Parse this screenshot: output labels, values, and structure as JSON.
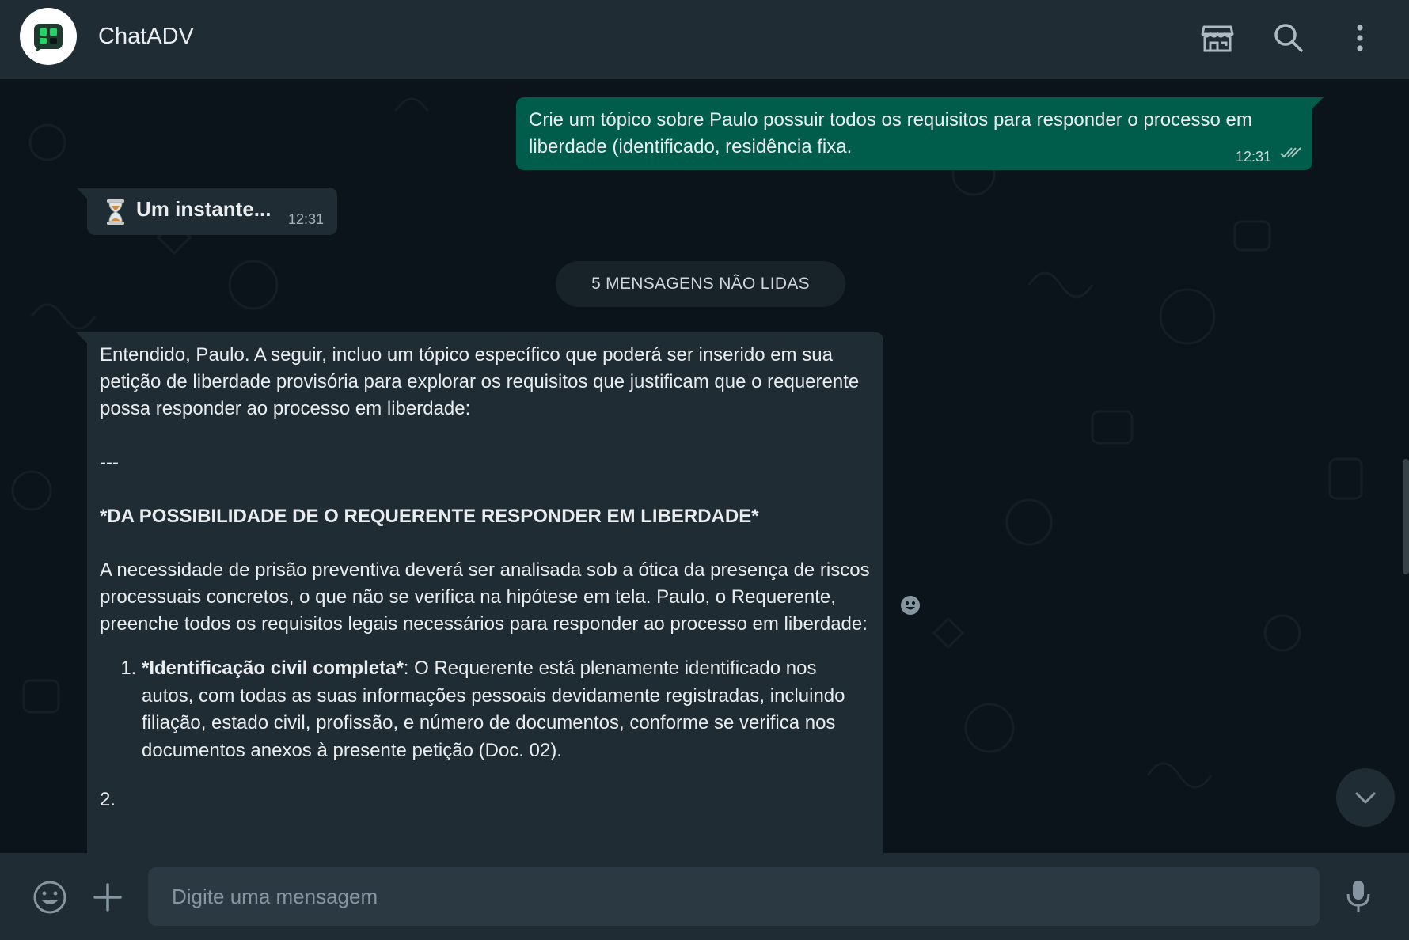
{
  "header": {
    "title": "ChatADV",
    "avatar_icon": "chatadv-logo-icon",
    "icons": [
      "store-icon",
      "search-icon",
      "menu-icon"
    ]
  },
  "messages": {
    "outgoing": {
      "text": "Crie um tópico sobre Paulo possuir todos os requisitos para responder o processo em liberdade (identificado, residência fixa.",
      "time": "12:31",
      "status_icon": "double-check-icon"
    },
    "waiting": {
      "icon": "hourglass-icon",
      "text": "Um instante...",
      "time": "12:31"
    },
    "unread_banner": "5 MENSAGENS NÃO LIDAS",
    "reply": {
      "intro": "Entendido, Paulo. A seguir, incluo um tópico específico que poderá ser inserido em sua petição de liberdade provisória para explorar os requisitos que justificam que o requerente possa responder ao processo em liberdade:",
      "separator": "---",
      "heading": "*DA POSSIBILIDADE DE O REQUERENTE RESPONDER EM LIBERDADE*",
      "paragraph": "A necessidade de prisão preventiva deverá ser analisada sob a ótica da presença de riscos processuais concretos, o que não se verifica na hipótese em tela. Paulo, o Requerente, preenche todos os requisitos legais necessários para responder ao processo em liberdade:",
      "items": [
        {
          "bold": "*Identificação civil completa*",
          "text": ": O Requerente está plenamente identificado nos autos, com todas as suas informações pessoais devidamente registradas, incluindo filiação, estado civil, profissão, e número de documentos, conforme se verifica nos documentos anexos à presente petição (Doc. 02)."
        }
      ],
      "next_number": "2."
    }
  },
  "footer": {
    "placeholder": "Digite uma mensagem",
    "icons": [
      "emoji-icon",
      "plus-icon",
      "microphone-icon"
    ]
  },
  "colors": {
    "header_bg": "#202c33",
    "chat_bg": "#0b141a",
    "outgoing_bubble": "#005c4b",
    "incoming_bubble": "#202c33"
  }
}
